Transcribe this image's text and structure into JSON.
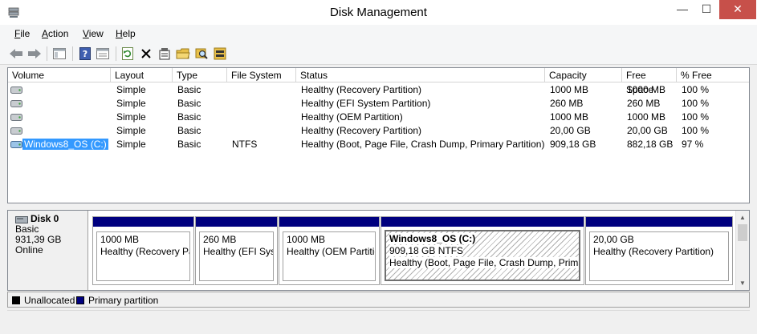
{
  "window": {
    "title": "Disk Management",
    "minimize_label": "—",
    "maximize_label": "☐",
    "close_label": "✕"
  },
  "menu": [
    {
      "label": "File",
      "mnemonic": "F",
      "rest": "ile"
    },
    {
      "label": "Action",
      "mnemonic": "A",
      "rest": "ction"
    },
    {
      "label": "View",
      "mnemonic": "V",
      "rest": "iew"
    },
    {
      "label": "Help",
      "mnemonic": "H",
      "rest": "elp"
    }
  ],
  "toolbar": {
    "icons": [
      "back-arrow-icon",
      "forward-arrow-icon",
      "show-hide-console-tree-icon",
      "help-icon",
      "properties-pane-icon",
      "refresh-icon",
      "delete-icon",
      "properties-icon",
      "open-folder-icon",
      "explore-icon",
      "disk-properties-icon"
    ]
  },
  "volume_list": {
    "columns": [
      "Volume",
      "Layout",
      "Type",
      "File System",
      "Status",
      "Capacity",
      "Free Space",
      "% Free"
    ],
    "rows": [
      {
        "volume": "",
        "layout": "Simple",
        "type": "Basic",
        "fs": "",
        "status": "Healthy (Recovery Partition)",
        "capacity": "1000 MB",
        "free": "1000 MB",
        "pct": "100 %"
      },
      {
        "volume": "",
        "layout": "Simple",
        "type": "Basic",
        "fs": "",
        "status": "Healthy (EFI System Partition)",
        "capacity": "260 MB",
        "free": "260 MB",
        "pct": "100 %"
      },
      {
        "volume": "",
        "layout": "Simple",
        "type": "Basic",
        "fs": "",
        "status": "Healthy (OEM Partition)",
        "capacity": "1000 MB",
        "free": "1000 MB",
        "pct": "100 %"
      },
      {
        "volume": "",
        "layout": "Simple",
        "type": "Basic",
        "fs": "",
        "status": "Healthy (Recovery Partition)",
        "capacity": "20,00 GB",
        "free": "20,00 GB",
        "pct": "100 %"
      },
      {
        "volume": "Windows8_OS (C:)",
        "layout": "Simple",
        "type": "Basic",
        "fs": "NTFS",
        "status": "Healthy (Boot, Page File, Crash Dump, Primary Partition)",
        "capacity": "909,18 GB",
        "free": "882,18 GB",
        "pct": "97 %"
      }
    ]
  },
  "disk": {
    "name": "Disk 0",
    "type": "Basic",
    "size": "931,39 GB",
    "state": "Online",
    "partitions": [
      {
        "title": "",
        "size": "1000 MB",
        "status": "Healthy (Recovery Pa"
      },
      {
        "title": "",
        "size": "260 MB",
        "status": "Healthy (EFI Syst"
      },
      {
        "title": "",
        "size": "1000 MB",
        "status": "Healthy (OEM Partitic"
      },
      {
        "title": "Windows8_OS  (C:)",
        "size": "909,18 GB NTFS",
        "status": "Healthy (Boot, Page File, Crash Dump, Primar"
      },
      {
        "title": "",
        "size": "20,00 GB",
        "status": "Healthy (Recovery Partition)"
      }
    ]
  },
  "legend": [
    {
      "label": "Unallocated",
      "color": "#000000"
    },
    {
      "label": "Primary partition",
      "color": "#00007f"
    }
  ],
  "colors": {
    "partition_bar": "#00007f",
    "selection": "#3399ff",
    "close_button": "#c7504a"
  }
}
